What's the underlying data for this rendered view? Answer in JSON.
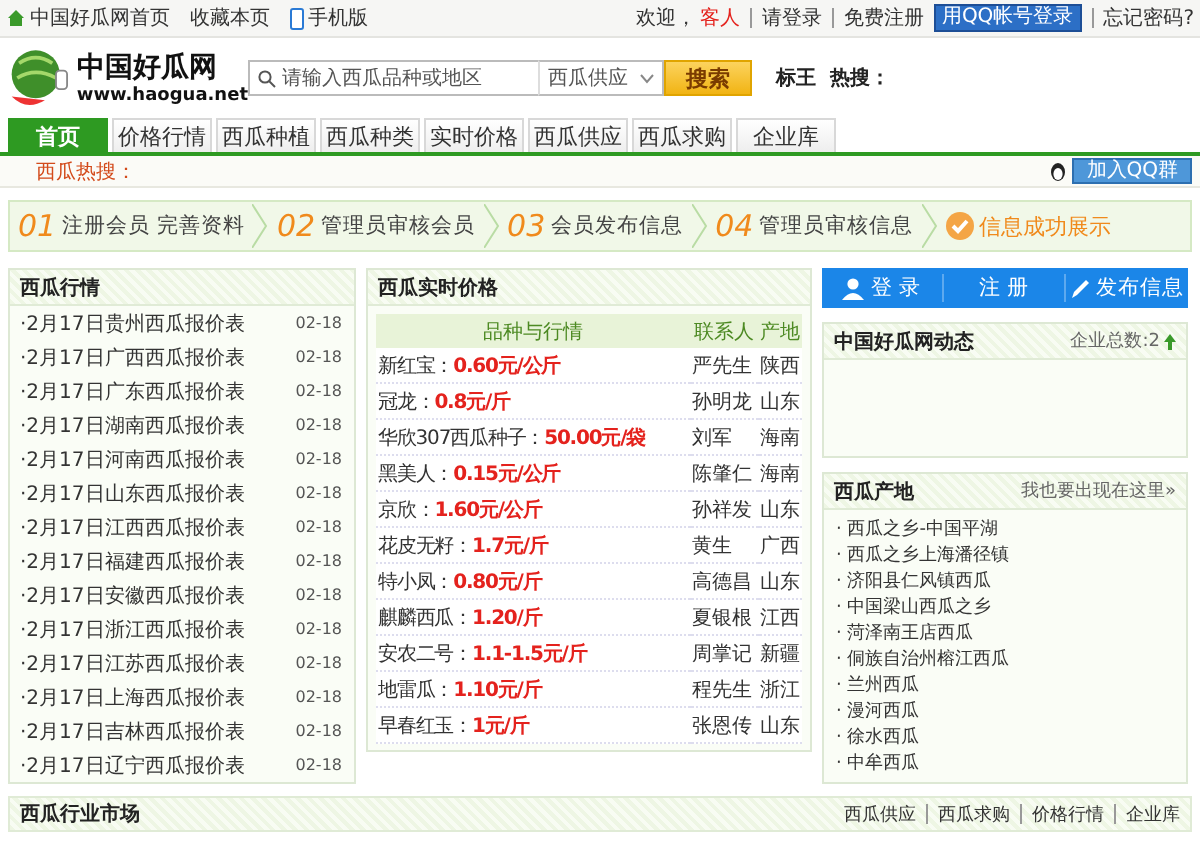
{
  "top_bar": {
    "links": [
      {
        "label": "中国好瓜网首页",
        "kind": "home"
      },
      {
        "label": "收藏本页",
        "kind": "plain"
      },
      {
        "label": "手机版",
        "kind": "phone"
      }
    ],
    "welcome": "欢迎，",
    "guest": "客人",
    "login": "请登录",
    "register": "免费注册",
    "qq_login": "用QQ帐号登录",
    "forgot": "忘记密码?"
  },
  "header": {
    "logo_name": "中国好瓜网",
    "logo_url": "www.haogua.net",
    "search": {
      "placeholder": "请输入西瓜品种或地区",
      "category": "西瓜供应",
      "button": "搜索"
    },
    "hot_label": "标王  热搜："
  },
  "nav": [
    {
      "label": "首页",
      "selected": true
    },
    {
      "label": "价格行情",
      "selected": false
    },
    {
      "label": "西瓜种植",
      "selected": false
    },
    {
      "label": "西瓜种类",
      "selected": false
    },
    {
      "label": "实时价格",
      "selected": false
    },
    {
      "label": "西瓜供应",
      "selected": false
    },
    {
      "label": "西瓜求购",
      "selected": false
    },
    {
      "label": "企业库",
      "selected": false
    }
  ],
  "hot_search": {
    "label": "西瓜热搜：",
    "qq_group": "加入QQ群"
  },
  "steps": [
    {
      "number": "01",
      "label": "注册会员 完善资料"
    },
    {
      "number": "02",
      "label": "管理员审核会员"
    },
    {
      "number": "03",
      "label": "会员发布信息"
    },
    {
      "number": "04",
      "label": "管理员审核信息"
    }
  ],
  "steps_final": "信息成功展示",
  "market": {
    "title": "西瓜行情",
    "items": [
      {
        "title": "·2月17日贵州西瓜报价表",
        "date": "02-18"
      },
      {
        "title": "·2月17日广西西瓜报价表",
        "date": "02-18"
      },
      {
        "title": "·2月17日广东西瓜报价表",
        "date": "02-18"
      },
      {
        "title": "·2月17日湖南西瓜报价表",
        "date": "02-18"
      },
      {
        "title": "·2月17日河南西瓜报价表",
        "date": "02-18"
      },
      {
        "title": "·2月17日山东西瓜报价表",
        "date": "02-18"
      },
      {
        "title": "·2月17日江西西瓜报价表",
        "date": "02-18"
      },
      {
        "title": "·2月17日福建西瓜报价表",
        "date": "02-18"
      },
      {
        "title": "·2月17日安徽西瓜报价表",
        "date": "02-18"
      },
      {
        "title": "·2月17日浙江西瓜报价表",
        "date": "02-18"
      },
      {
        "title": "·2月17日江苏西瓜报价表",
        "date": "02-18"
      },
      {
        "title": "·2月17日上海西瓜报价表",
        "date": "02-18"
      },
      {
        "title": "·2月17日吉林西瓜报价表",
        "date": "02-18"
      },
      {
        "title": "·2月17日辽宁西瓜报价表",
        "date": "02-18"
      }
    ]
  },
  "prices": {
    "title": "西瓜实时价格",
    "columns": [
      "品种与行情",
      "联系人",
      "产地"
    ],
    "rows": [
      {
        "variety": "新红宝：",
        "price": "0.60元/公斤",
        "contact": "严先生",
        "origin": "陕西"
      },
      {
        "variety": "冠龙：",
        "price": "0.8元/斤",
        "contact": "孙明龙",
        "origin": "山东"
      },
      {
        "variety": "华欣307西瓜种子：",
        "price": "50.00元/袋",
        "contact": "刘军",
        "origin": "海南"
      },
      {
        "variety": "黑美人：",
        "price": "0.15元/公斤",
        "contact": "陈肇仁",
        "origin": "海南"
      },
      {
        "variety": "京欣：",
        "price": "1.60元/公斤",
        "contact": "孙祥发",
        "origin": "山东"
      },
      {
        "variety": "花皮无籽：",
        "price": "1.7元/斤",
        "contact": "黄生",
        "origin": "广西"
      },
      {
        "variety": "特小凤：",
        "price": "0.80元/斤",
        "contact": "高德昌",
        "origin": "山东"
      },
      {
        "variety": "麒麟西瓜：",
        "price": "1.20/斤",
        "contact": "夏银根",
        "origin": "江西"
      },
      {
        "variety": "安农二号：",
        "price": "1.1-1.5元/斤",
        "contact": "周掌记",
        "origin": "新疆"
      },
      {
        "variety": "地雷瓜：",
        "price": "1.10元/斤",
        "contact": "程先生",
        "origin": "浙江"
      },
      {
        "variety": "早春红玉：",
        "price": "1元/斤",
        "contact": "张恩传",
        "origin": "山东"
      }
    ]
  },
  "account_bar": [
    {
      "label": "登 录",
      "kind": "user"
    },
    {
      "label": "注 册",
      "kind": "plain"
    },
    {
      "label": "发布信息",
      "kind": "pencil"
    }
  ],
  "news": {
    "title": "中国好瓜网动态",
    "count": "企业总数:2"
  },
  "origins": {
    "title": "西瓜产地",
    "link": "我也要出现在这里»",
    "items": [
      "· 西瓜之乡-中国平湖",
      "· 西瓜之乡上海潘径镇",
      "· 济阳县仁风镇西瓜",
      "· 中国梁山西瓜之乡",
      "· 菏泽南王店西瓜",
      "· 侗族自治州榕江西瓜",
      "· 兰州西瓜",
      "· 漫河西瓜",
      "· 徐水西瓜",
      "· 中牟西瓜"
    ]
  },
  "industry": {
    "title": "西瓜行业市场",
    "links": [
      "西瓜供应",
      "西瓜求购",
      "价格行情",
      "企业库"
    ]
  }
}
